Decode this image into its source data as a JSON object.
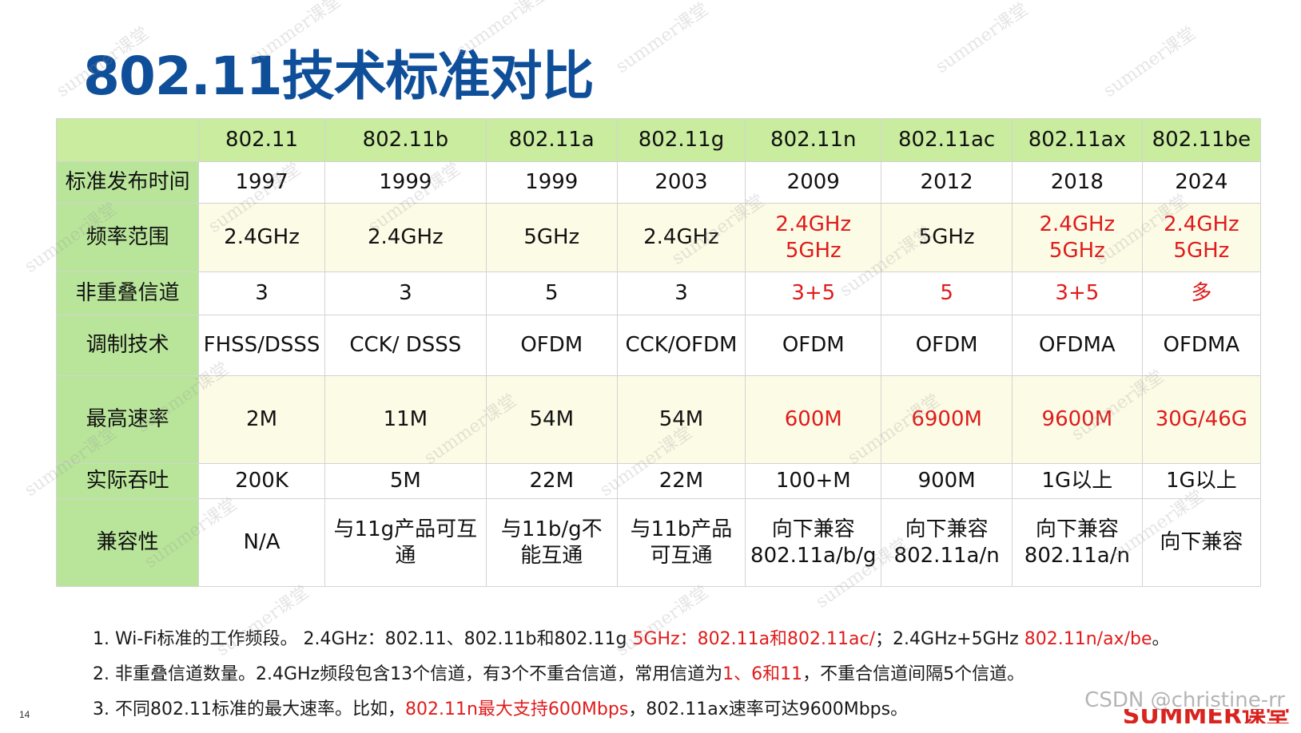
{
  "title": "802.11技术标准对比",
  "table": {
    "headers": [
      "",
      "802.11",
      "802.11b",
      "802.11a",
      "802.11g",
      "802.11n",
      "802.11ac",
      "802.11ax",
      "802.11be"
    ],
    "rows": [
      {
        "label": "标准发布时间",
        "cells": [
          {
            "lines": [
              "1997"
            ],
            "red": false
          },
          {
            "lines": [
              "1999"
            ],
            "red": false
          },
          {
            "lines": [
              "1999"
            ],
            "red": false
          },
          {
            "lines": [
              "2003"
            ],
            "red": false
          },
          {
            "lines": [
              "2009"
            ],
            "red": false
          },
          {
            "lines": [
              "2012"
            ],
            "red": false
          },
          {
            "lines": [
              "2018"
            ],
            "red": false
          },
          {
            "lines": [
              "2024"
            ],
            "red": false
          }
        ]
      },
      {
        "label": "频率范围",
        "cells": [
          {
            "lines": [
              "2.4GHz"
            ],
            "red": false
          },
          {
            "lines": [
              "2.4GHz"
            ],
            "red": false
          },
          {
            "lines": [
              "5GHz"
            ],
            "red": false
          },
          {
            "lines": [
              "2.4GHz"
            ],
            "red": false
          },
          {
            "lines": [
              "2.4GHz",
              "5GHz"
            ],
            "red": true
          },
          {
            "lines": [
              "5GHz"
            ],
            "red": false
          },
          {
            "lines": [
              "2.4GHz",
              "5GHz"
            ],
            "red": true
          },
          {
            "lines": [
              "2.4GHz",
              "5GHz"
            ],
            "red": true
          }
        ]
      },
      {
        "label": "非重叠信道",
        "cells": [
          {
            "lines": [
              "3"
            ],
            "red": false
          },
          {
            "lines": [
              "3"
            ],
            "red": false
          },
          {
            "lines": [
              "5"
            ],
            "red": false
          },
          {
            "lines": [
              "3"
            ],
            "red": false
          },
          {
            "lines": [
              "3+5"
            ],
            "red": true
          },
          {
            "lines": [
              "5"
            ],
            "red": true
          },
          {
            "lines": [
              "3+5"
            ],
            "red": true
          },
          {
            "lines": [
              "多"
            ],
            "red": true
          }
        ]
      },
      {
        "label": "调制技术",
        "cells": [
          {
            "lines": [
              "FHSS/DSSS"
            ],
            "red": false
          },
          {
            "lines": [
              "CCK/ DSSS"
            ],
            "red": false
          },
          {
            "lines": [
              "OFDM"
            ],
            "red": false
          },
          {
            "lines": [
              "CCK/OFDM"
            ],
            "red": false
          },
          {
            "lines": [
              "OFDM"
            ],
            "red": false
          },
          {
            "lines": [
              "OFDM"
            ],
            "red": false
          },
          {
            "lines": [
              "OFDMA"
            ],
            "red": false
          },
          {
            "lines": [
              "OFDMA"
            ],
            "red": false
          }
        ]
      },
      {
        "label": "最高速率",
        "cells": [
          {
            "lines": [
              "2M"
            ],
            "red": false
          },
          {
            "lines": [
              "11M"
            ],
            "red": false
          },
          {
            "lines": [
              "54M"
            ],
            "red": false
          },
          {
            "lines": [
              "54M"
            ],
            "red": false
          },
          {
            "lines": [
              "600M"
            ],
            "red": true
          },
          {
            "lines": [
              "6900M"
            ],
            "red": true
          },
          {
            "lines": [
              "9600M"
            ],
            "red": true
          },
          {
            "lines": [
              "30G/46G"
            ],
            "red": true
          }
        ]
      },
      {
        "label": "实际吞吐",
        "cells": [
          {
            "lines": [
              "200K"
            ],
            "red": false
          },
          {
            "lines": [
              "5M"
            ],
            "red": false
          },
          {
            "lines": [
              "22M"
            ],
            "red": false
          },
          {
            "lines": [
              "22M"
            ],
            "red": false
          },
          {
            "lines": [
              "100+M"
            ],
            "red": false
          },
          {
            "lines": [
              "900M"
            ],
            "red": false
          },
          {
            "lines": [
              "1G以上"
            ],
            "red": false
          },
          {
            "lines": [
              "1G以上"
            ],
            "red": false
          }
        ]
      },
      {
        "label": "兼容性",
        "cells": [
          {
            "lines": [
              "N/A"
            ],
            "red": false
          },
          {
            "lines": [
              "与11g产品可互",
              "通"
            ],
            "red": false
          },
          {
            "lines": [
              "与11b/g不",
              "能互通"
            ],
            "red": false
          },
          {
            "lines": [
              "与11b产品",
              "可互通"
            ],
            "red": false
          },
          {
            "lines": [
              "向下兼容",
              "802.11a/b/g"
            ],
            "red": false
          },
          {
            "lines": [
              "向下兼容",
              "802.11a/n"
            ],
            "red": false
          },
          {
            "lines": [
              "向下兼容",
              "802.11a/n"
            ],
            "red": false
          },
          {
            "lines": [
              "向下兼容"
            ],
            "red": false
          }
        ]
      }
    ]
  },
  "notes": [
    {
      "segments": [
        {
          "text": "1. Wi-Fi标准的工作频段。 2.4GHz：802.11、802.11b和802.11g ",
          "red": false
        },
        {
          "text": "5GHz：802.11a和802.11ac/",
          "red": true
        },
        {
          "text": "；2.4GHz+5GHz ",
          "red": false
        },
        {
          "text": "802.11n/ax/be",
          "red": true
        },
        {
          "text": "。",
          "red": false
        }
      ]
    },
    {
      "segments": [
        {
          "text": "2. 非重叠信道数量。2.4GHz频段包含13个信道，有3个不重合信道，常用信道为",
          "red": false
        },
        {
          "text": "1、6和11",
          "red": true
        },
        {
          "text": "，不重合信道间隔5个信道。",
          "red": false
        }
      ]
    },
    {
      "segments": [
        {
          "text": "3. 不同802.11标准的最大速率。比如，",
          "red": false
        },
        {
          "text": "802.11n最大支持600Mbps",
          "red": true
        },
        {
          "text": "，802.11ax速率可达9600Mbps。",
          "red": false
        }
      ]
    }
  ],
  "page_number": "14",
  "csdn_watermark": "CSDN @christine-rr",
  "logo_text": "SUMMER课堂",
  "watermark_text": "summer课堂"
}
